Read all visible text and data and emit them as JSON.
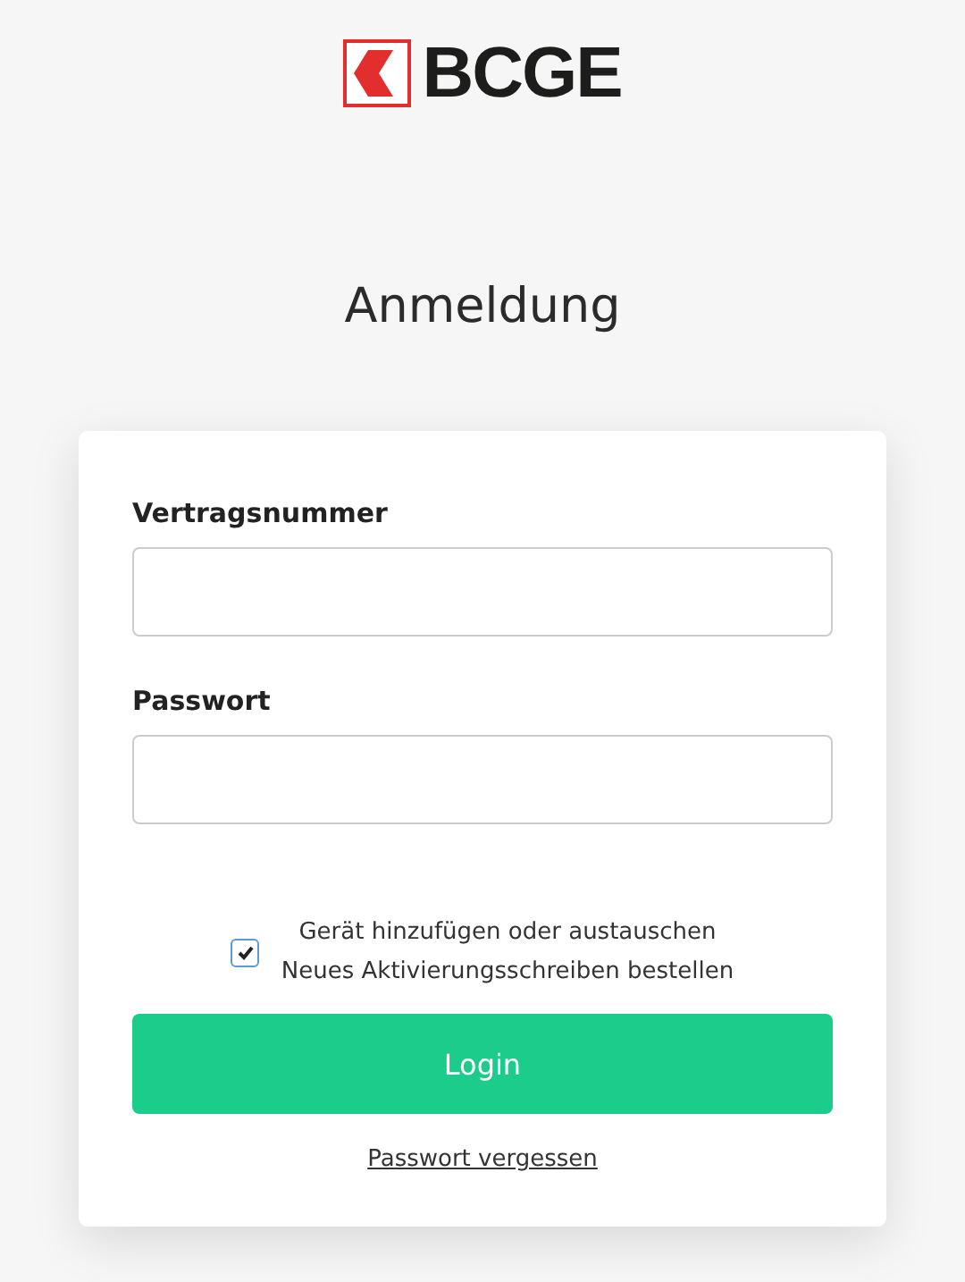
{
  "logo": {
    "text": "BCGE"
  },
  "title": "Anmeldung",
  "form": {
    "fields": [
      {
        "label": "Vertragsnummer"
      },
      {
        "label": "Passwort"
      }
    ],
    "checkbox": {
      "checked": true,
      "lines": [
        "Gerät hinzufügen oder austauschen",
        "Neues Aktivierungsschreiben bestellen"
      ]
    },
    "button": "Login",
    "link": "Passwort vergessen"
  }
}
